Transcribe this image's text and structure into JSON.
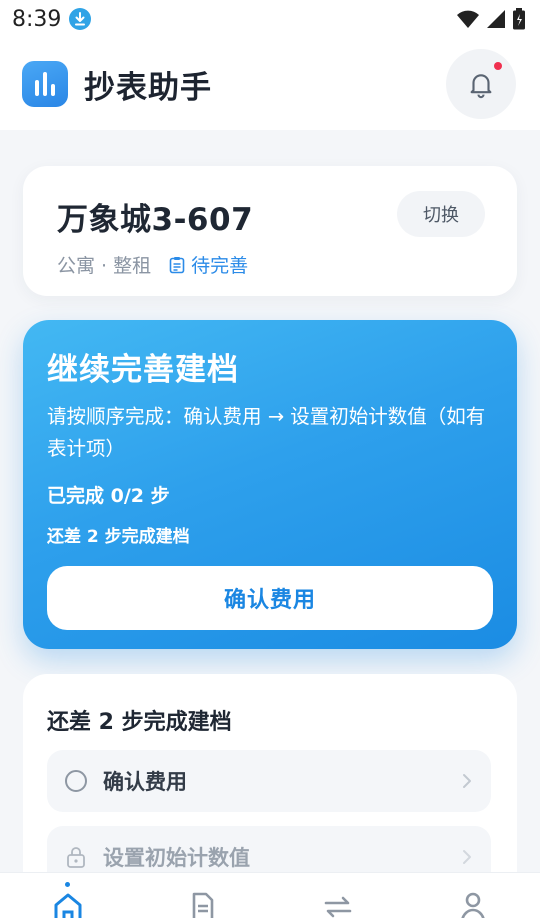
{
  "status_bar": {
    "time": "8:39",
    "icons": [
      "download-icon",
      "wifi-icon",
      "signal-icon",
      "battery-icon"
    ]
  },
  "header": {
    "title": "抄表助手",
    "logo_icon": "bar-chart-icon",
    "notification_icon": "bell-icon",
    "has_unread": true
  },
  "property": {
    "name": "万象城3-607",
    "type": "公寓 · 整租",
    "status": "待完善",
    "status_icon": "clipboard-icon",
    "switch_label": "切换"
  },
  "progress_card": {
    "title": "继续完善建档",
    "description": "请按顺序完成：确认费用 → 设置初始计数值（如有表计项）",
    "progress": "已完成 0/2 步",
    "remaining": "还差 2 步完成建档",
    "completed_steps": 0,
    "total_steps": 2,
    "button_label": "确认费用"
  },
  "steps_card": {
    "title": "还差 2 步完成建档",
    "steps": [
      {
        "label": "确认费用",
        "icon": "circle-icon",
        "locked": false
      },
      {
        "label": "设置初始计数值",
        "icon": "lock-icon",
        "locked": true
      }
    ]
  },
  "bottom_nav": {
    "items": [
      {
        "icon": "home-icon",
        "active": true
      },
      {
        "icon": "document-icon",
        "active": false
      },
      {
        "icon": "swap-icon",
        "active": false
      },
      {
        "icon": "user-icon",
        "active": false
      }
    ]
  },
  "colors": {
    "accent": "#2b8be8",
    "card_gradient_start": "#43b8f3",
    "card_gradient_end": "#1b8ce3",
    "notification_dot": "#f0304f",
    "background": "#f4f6f9"
  }
}
